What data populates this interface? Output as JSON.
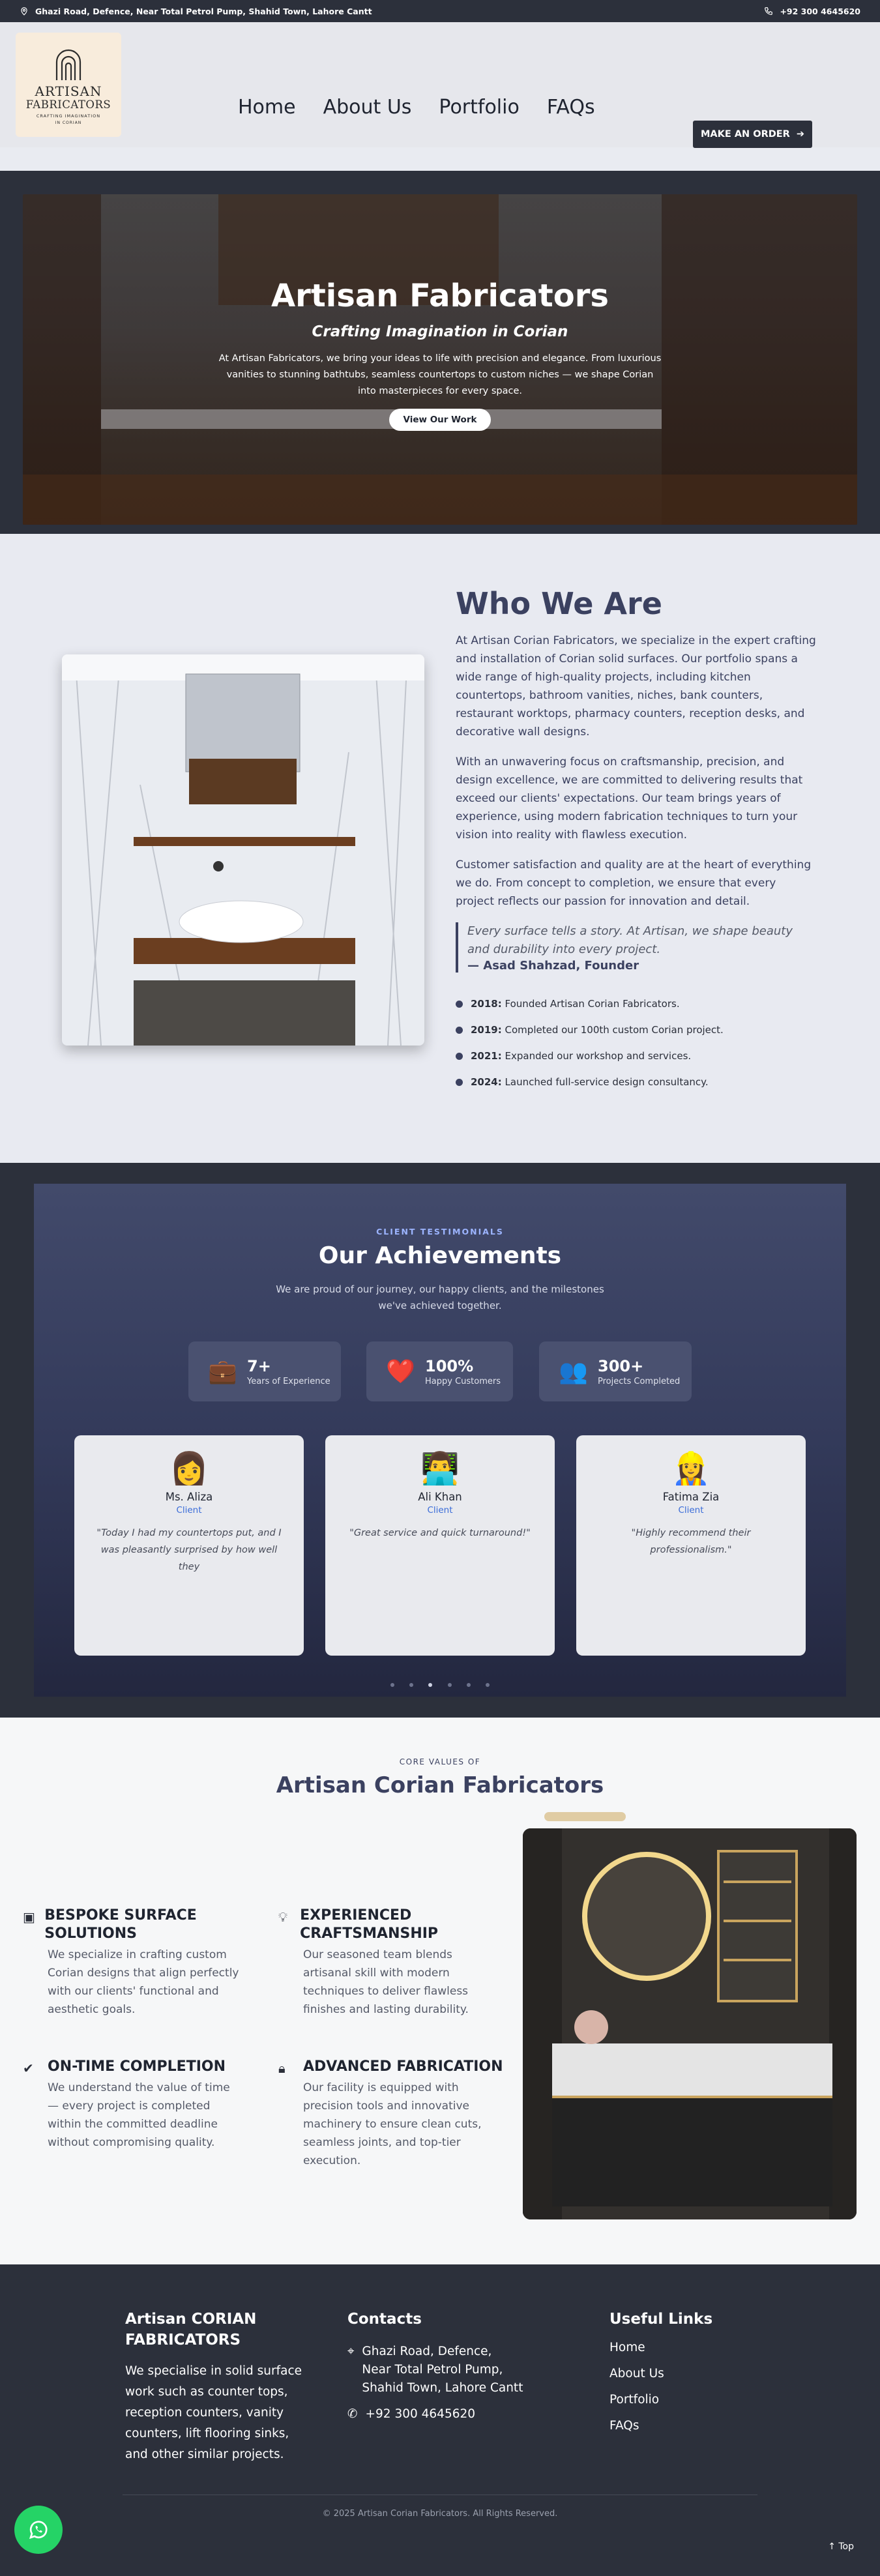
{
  "topbar": {
    "address": "Ghazi Road, Defence, Near Total Petrol Pump, Shahid Town, Lahore Cantt",
    "phone": "+92 300 4645620"
  },
  "logo": {
    "line1": "ARTISAN",
    "line2": "FABRICATORS",
    "line3": "CRAFTING IMAGINATION",
    "line4": "IN CORIAN"
  },
  "nav": {
    "items": [
      "Home",
      "About Us",
      "Portfolio",
      "FAQs"
    ],
    "cta": "MAKE AN ORDER"
  },
  "hero": {
    "title": "Artisan Fabricators",
    "subtitle": "Crafting Imagination in Corian",
    "text": "At Artisan Fabricators, we bring your ideas to life with precision and elegance. From luxurious vanities to stunning bathtubs, seamless countertops to custom niches — we shape Corian into masterpieces for every space.",
    "button": "View Our Work"
  },
  "who": {
    "title": "Who We Are",
    "p1": "At Artisan Corian Fabricators, we specialize in the expert crafting and installation of Corian solid surfaces. Our portfolio spans a wide range of high-quality projects, including kitchen countertops, bathroom vanities, niches, bank counters, restaurant worktops, pharmacy counters, reception desks, and decorative wall designs.",
    "p2": "With an unwavering focus on craftsmanship, precision, and design excellence, we are committed to delivering results that exceed our clients' expectations. Our team brings years of experience, using modern fabrication techniques to turn your vision into reality with flawless execution.",
    "p3": "Customer satisfaction and quality are at the heart of everything we do. From concept to completion, we ensure that every project reflects our passion for innovation and detail.",
    "quote": "Every surface tells a story. At Artisan, we shape beauty and durability into every project.",
    "quote_author": "— Asad Shahzad, Founder",
    "timeline": [
      {
        "year": "2018:",
        "text": "Founded Artisan Corian Fabricators."
      },
      {
        "year": "2019:",
        "text": "Completed our 100th custom Corian project."
      },
      {
        "year": "2021:",
        "text": "Expanded our workshop and services."
      },
      {
        "year": "2024:",
        "text": "Launched full-service design consultancy."
      }
    ]
  },
  "achievements": {
    "eyebrow": "CLIENT TESTIMONIALS",
    "title": "Our Achievements",
    "subtitle": "We are proud of our journey, our happy clients, and the milestones we've achieved together.",
    "stats": [
      {
        "icon": "briefcase-icon",
        "num": "7+",
        "label": "Years of Experience"
      },
      {
        "icon": "heart-icon",
        "num": "100%",
        "label": "Happy Customers"
      },
      {
        "icon": "people-icon",
        "num": "300+",
        "label": "Projects Completed"
      }
    ],
    "testimonials": [
      {
        "name": "Ms. Aliza",
        "role": "Client",
        "text": "\"Today I had my countertops put, and I was pleasantly surprised by how well they"
      },
      {
        "name": "Ali Khan",
        "role": "Client",
        "text": "\"Great service and quick turnaround!\""
      },
      {
        "name": "Fatima Zia",
        "role": "Client",
        "text": "\"Highly recommend their professionalism.\""
      }
    ]
  },
  "core": {
    "eyebrow": "CORE VALUES OF",
    "title": "Artisan Corian Fabricators",
    "values": [
      {
        "icon": "square-target-icon",
        "title": "BESPOKE SURFACE SOLUTIONS",
        "text": "We specialize in crafting custom Corian designs that align perfectly with our clients' functional and aesthetic goals."
      },
      {
        "icon": "lightbulb-icon",
        "title": "EXPERIENCED CRAFTSMANSHIP",
        "text": "Our seasoned team blends artisanal skill with modern techniques to deliver flawless finishes and lasting durability."
      },
      {
        "icon": "check-icon",
        "title": "ON-TIME COMPLETION",
        "text": "We understand the value of time — every project is completed within the committed deadline without compromising quality."
      },
      {
        "icon": "lock-icon",
        "title": "ADVANCED FABRICATION",
        "text": "Our facility is equipped with precision tools and innovative machinery to ensure clean cuts, seamless joints, and top-tier execution."
      }
    ]
  },
  "footer": {
    "brand_title": "Artisan CORIAN FABRICATORS",
    "brand_text": "We specialise in solid surface work such as counter tops, reception counters, vanity counters, lift flooring sinks, and other similar projects.",
    "contacts_title": "Contacts",
    "address": "Ghazi Road, Defence, Near Total Petrol Pump, Shahid Town, Lahore Cantt",
    "phone": "+92 300 4645620",
    "links_title": "Useful Links",
    "links": [
      "Home",
      "About Us",
      "Portfolio",
      "FAQs"
    ],
    "copyright": "© 2025 Artisan Corian Fabricators. All Rights Reserved.",
    "top": "↑ Top"
  }
}
